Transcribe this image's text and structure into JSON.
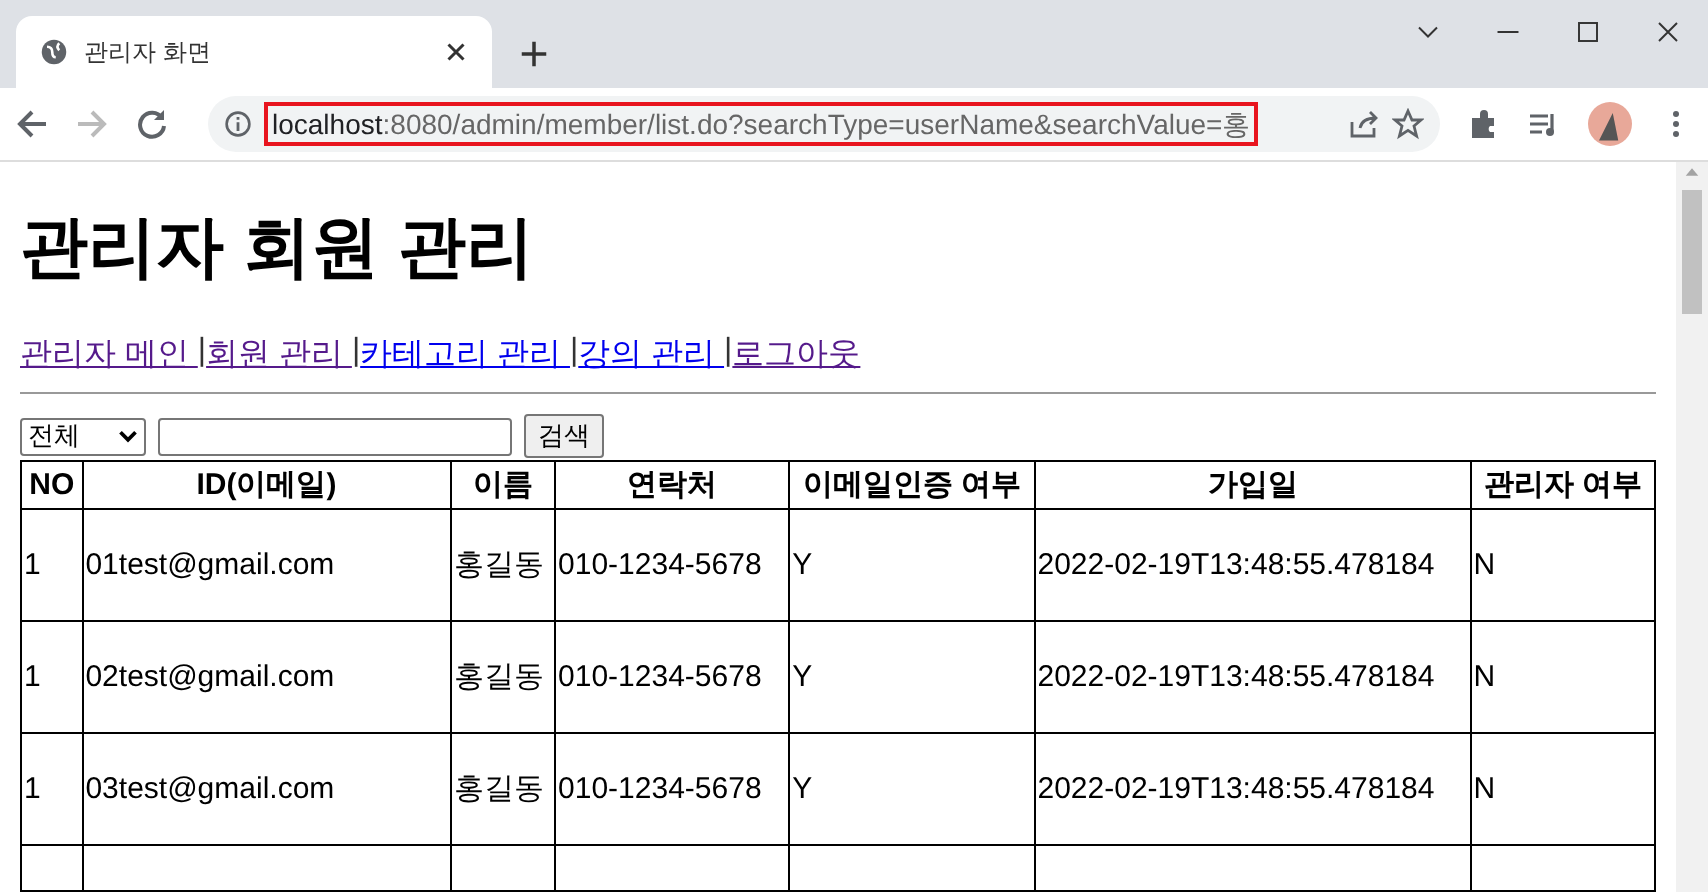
{
  "browser": {
    "tab_title": "관리자 화면",
    "url_host": "localhost",
    "url_rest": ":8080/admin/member/list.do?searchType=userName&searchValue=홍"
  },
  "page": {
    "title": "관리자 회원 관리",
    "nav": [
      {
        "label": "관리자 메인 ",
        "visited": true
      },
      {
        "label": "회원 관리 ",
        "visited": true
      },
      {
        "label": "카테고리 관리 ",
        "visited": false
      },
      {
        "label": "강의 관리 ",
        "visited": false
      },
      {
        "label": "로그아웃",
        "visited": true
      }
    ],
    "nav_separator": "|",
    "search": {
      "select_value": "전체",
      "button": "검색"
    },
    "table": {
      "columns": [
        "NO",
        "ID(이메일)",
        "이름",
        "연락처",
        "이메일인증 여부",
        "가입일",
        "관리자 여부"
      ],
      "rows": [
        [
          "1",
          "01test@gmail.com",
          "홍길동",
          "010-1234-5678",
          "Y",
          "2022-02-19T13:48:55.478184",
          "N"
        ],
        [
          "1",
          "02test@gmail.com",
          "홍길동",
          "010-1234-5678",
          "Y",
          "2022-02-19T13:48:55.478184",
          "N"
        ],
        [
          "1",
          "03test@gmail.com",
          "홍길동",
          "010-1234-5678",
          "Y",
          "2022-02-19T13:48:55.478184",
          "N"
        ]
      ]
    }
  }
}
